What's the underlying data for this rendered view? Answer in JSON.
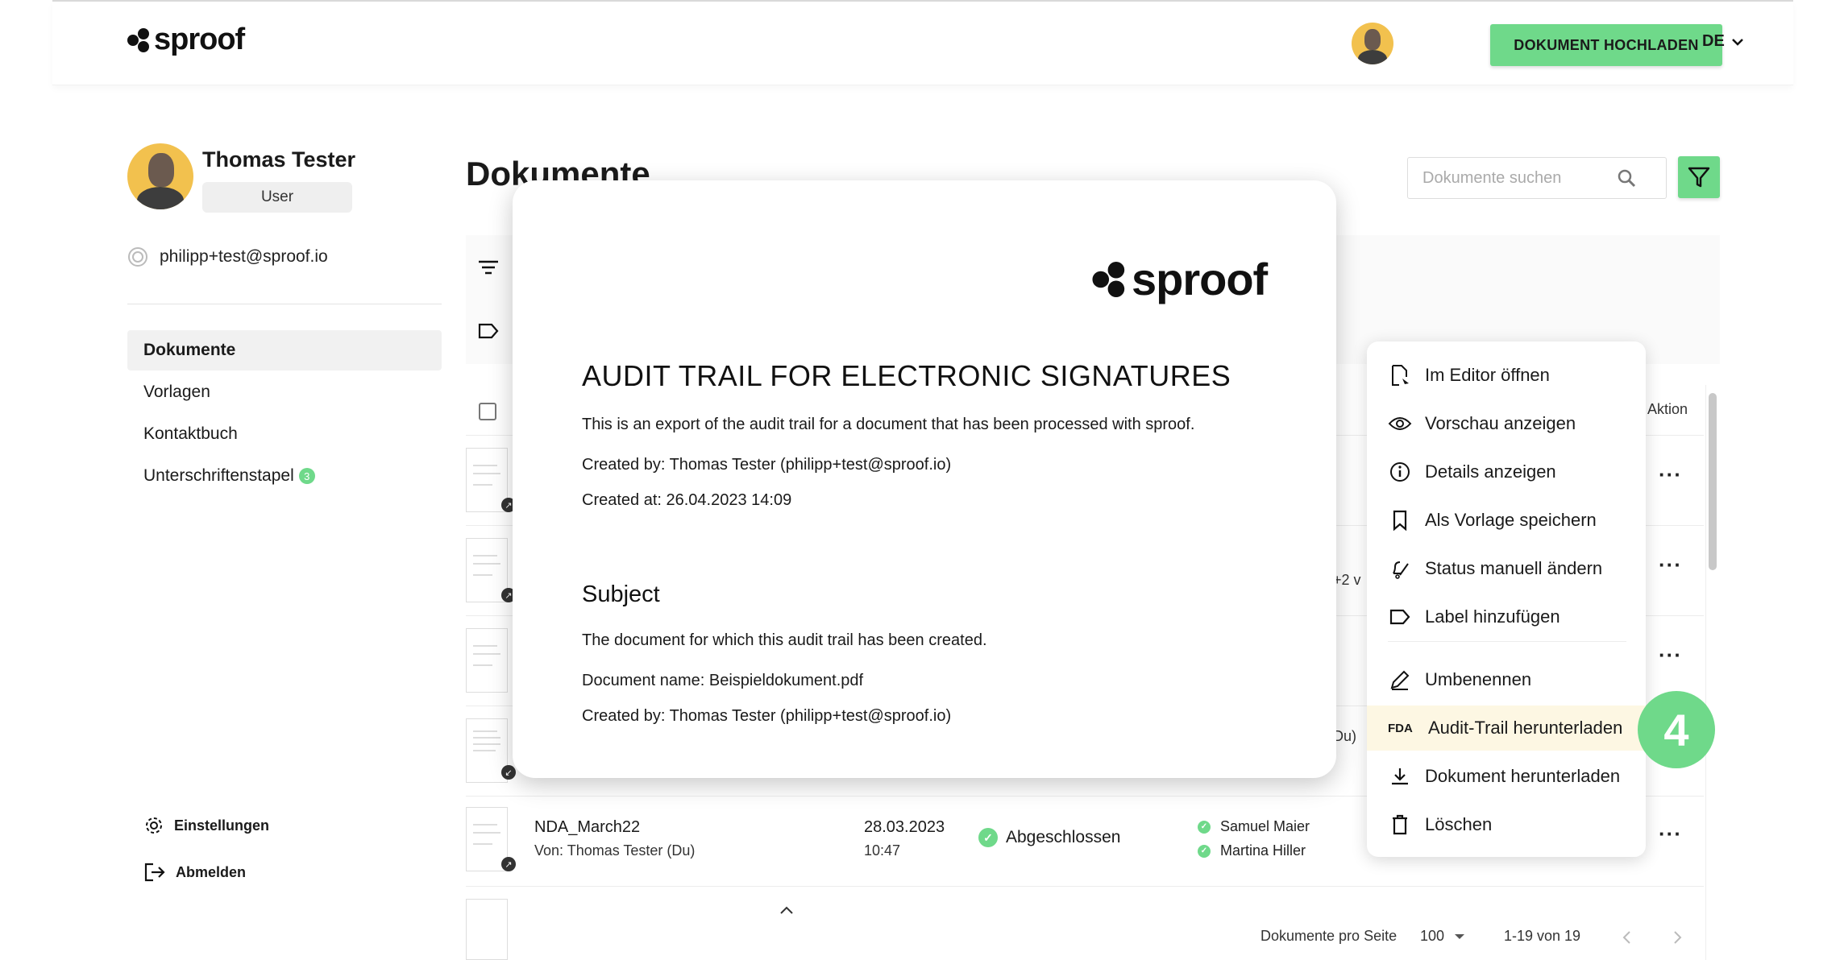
{
  "header": {
    "logo_text": "sproof",
    "upload_button": "DOKUMENT HOCHLADEN",
    "language": "DE"
  },
  "sidebar": {
    "user_name": "Thomas Tester",
    "role": "User",
    "email": "philipp+test@sproof.io",
    "items": [
      {
        "label": "Dokumente"
      },
      {
        "label": "Vorlagen"
      },
      {
        "label": "Kontaktbuch"
      },
      {
        "label": "Unterschriftenstapel",
        "badge": "3"
      }
    ],
    "settings_label": "Einstellungen",
    "logout_label": "Abmelden"
  },
  "main": {
    "title": "Dokumente",
    "search_placeholder": "Dokumente suchen",
    "action_header": "Aktion",
    "row_fragments": {
      "r2_more": "+2 v",
      "r4_du": "Du)"
    },
    "last_row": {
      "name": "NDA_March22",
      "from": "Von: Thomas Tester (Du)",
      "date": "28.03.2023",
      "time": "10:47",
      "status": "Abgeschlossen",
      "signers": [
        "Samuel Maier",
        "Martina Hiller"
      ]
    },
    "pagination": {
      "per_page_label": "Dokumente pro Seite",
      "per_page_value": "100",
      "range": "1-19 von 19"
    }
  },
  "modal": {
    "logo_text": "sproof",
    "title": "AUDIT TRAIL FOR ELECTRONIC SIGNATURES",
    "intro": "This is an export of the audit trail for a document that has been processed with sproof.",
    "created_by": "Created by: Thomas Tester (philipp+test@sproof.io)",
    "created_at": "Created at: 26.04.2023 14:09",
    "subject_heading": "Subject",
    "subject_text": "The document for which this audit trail has been created.",
    "document_name": "Document name: Beispieldokument.pdf",
    "subject_created_by": "Created by: Thomas Tester (philipp+test@sproof.io)"
  },
  "context_menu": {
    "items": [
      {
        "label": "Im Editor öffnen",
        "icon": "editor-icon"
      },
      {
        "label": "Vorschau anzeigen",
        "icon": "eye-icon"
      },
      {
        "label": "Details anzeigen",
        "icon": "info-icon"
      },
      {
        "label": "Als Vorlage speichern",
        "icon": "bookmark-icon"
      },
      {
        "label": "Status manuell ändern",
        "icon": "bell-edit-icon"
      },
      {
        "label": "Label hinzufügen",
        "icon": "label-icon"
      },
      {
        "label": "Umbenennen",
        "icon": "pen-icon"
      },
      {
        "label": "Audit-Trail herunterladen",
        "icon": "fda-icon",
        "prefix": "FDA"
      },
      {
        "label": "Dokument herunterladen",
        "icon": "download-icon"
      },
      {
        "label": "Löschen",
        "icon": "trash-icon"
      }
    ]
  },
  "step_badge": "4",
  "colors": {
    "accent": "#6fd98a",
    "highlight": "#fdf7e3",
    "avatar_bg": "#f2c14e"
  }
}
